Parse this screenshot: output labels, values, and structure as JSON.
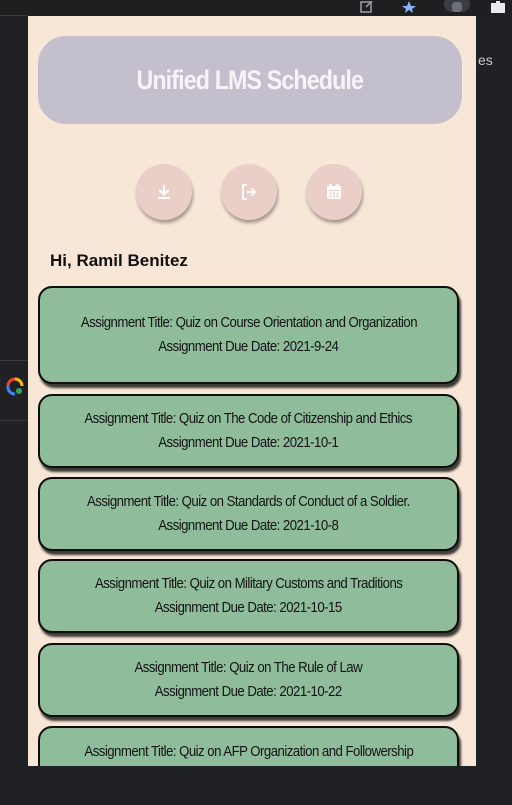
{
  "browser": {
    "background_text": "es",
    "icons": [
      "open-in-new-icon",
      "star-icon",
      "profile-icon",
      "puzzle-icon",
      "google-lens-icon"
    ]
  },
  "popup": {
    "title": "Unified LMS Schedule",
    "actions": [
      {
        "icon": "download-icon"
      },
      {
        "icon": "logout-icon"
      },
      {
        "icon": "calendar-icon"
      }
    ],
    "greeting": "Hi, Ramil Benitez",
    "assignments": [
      {
        "title_line": "Assignment Title: Quiz on Course Orientation and Organization",
        "due_line": "Assignment Due Date: 2021-9-24"
      },
      {
        "title_line": "Assignment Title: Quiz on The Code of Citizenship and Ethics",
        "due_line": "Assignment Due Date: 2021-10-1"
      },
      {
        "title_line": "Assignment Title: Quiz on Standards of Conduct of a Soldier.",
        "due_line": "Assignment Due Date: 2021-10-8"
      },
      {
        "title_line": "Assignment Title: Quiz on Military Customs and Traditions",
        "due_line": "Assignment Due Date: 2021-10-15"
      },
      {
        "title_line": "Assignment Title: Quiz on The Rule of Law",
        "due_line": "Assignment Due Date: 2021-10-22"
      },
      {
        "title_line": "Assignment Title: Quiz on AFP Organization and Followership",
        "due_line": ""
      }
    ]
  },
  "colors": {
    "popup_bg": "#f8e6d6",
    "header_bg": "#c4bfcc",
    "card_bg": "#8fbc9a",
    "button_bg": "#e9cfc8"
  }
}
